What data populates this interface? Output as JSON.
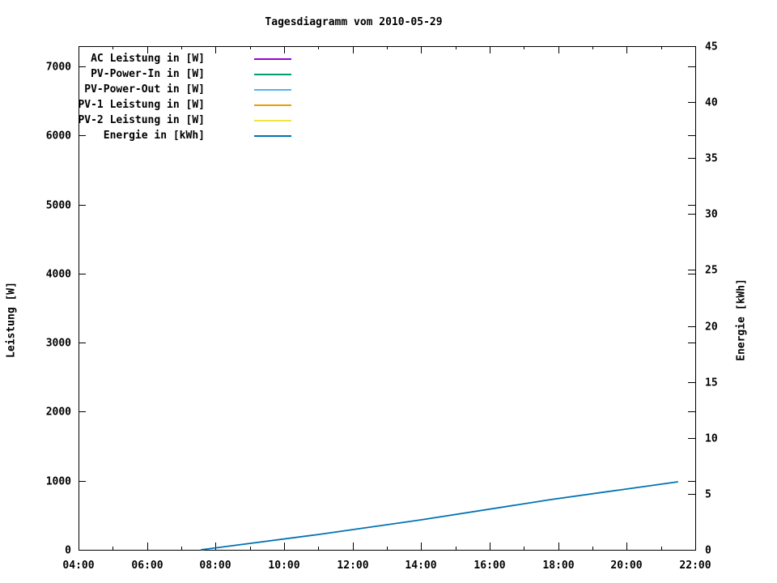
{
  "chart_data": {
    "type": "line",
    "title": "Tagesdiagramm vom 2010-05-29",
    "ylabel_left": "Leistung [W]",
    "ylabel_right": "Energie [kWh]",
    "grid": false,
    "legend_position": "top-left-inside",
    "x_axis": {
      "range_hours": [
        4,
        22
      ],
      "hours_major": [
        4,
        6,
        8,
        10,
        12,
        14,
        16,
        18,
        20,
        22
      ],
      "labels": [
        "04:00",
        "06:00",
        "08:00",
        "10:00",
        "12:00",
        "14:00",
        "16:00",
        "18:00",
        "20:00",
        "22:00"
      ],
      "hours_minor": [
        5,
        7,
        9,
        11,
        13,
        15,
        17,
        19,
        21
      ]
    },
    "y_axis_left": {
      "label": "Leistung [W]",
      "ticks": [
        0,
        1000,
        2000,
        3000,
        4000,
        5000,
        6000,
        7000
      ],
      "range": [
        0,
        7292
      ]
    },
    "y_axis_right": {
      "label": "Energie [kWh]",
      "ticks": [
        0,
        5,
        10,
        15,
        20,
        25,
        30,
        35,
        40,
        45
      ],
      "range": [
        0,
        45
      ]
    },
    "legend": [
      {
        "label": "AC Leistung in [W]",
        "color": "#9400d3"
      },
      {
        "label": "PV-Power-In in [W]",
        "color": "#009e73"
      },
      {
        "label": "PV-Power-Out in [W]",
        "color": "#56b4e9"
      },
      {
        "label": "PV-1 Leistung in [W]",
        "color": "#e69f00"
      },
      {
        "label": "PV-2 Leistung in [W]",
        "color": "#f0e442"
      },
      {
        "label": "Energie in [kWh]",
        "color": "#0072b2"
      }
    ],
    "series": [
      {
        "name": "Energie in [kWh]",
        "axis": "right",
        "color": "#0072b2",
        "points": [
          [
            7.57,
            0
          ],
          [
            11.0,
            1.37
          ],
          [
            14.0,
            2.68
          ],
          [
            17.8,
            4.49
          ],
          [
            21.5,
            6.08
          ]
        ]
      }
    ]
  }
}
